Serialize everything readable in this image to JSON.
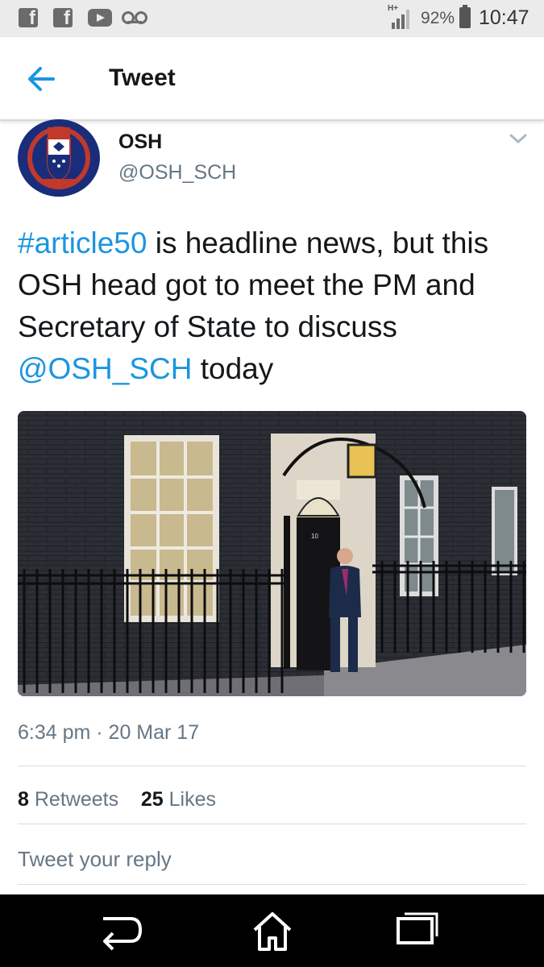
{
  "status_bar": {
    "network": "H+",
    "battery_percent": "92%",
    "battery_level": 0.92,
    "time": "10:47",
    "icons": [
      "facebook-icon",
      "facebook-icon",
      "youtube-icon",
      "voicemail-icon",
      "signal-icon",
      "battery-icon"
    ]
  },
  "app_bar": {
    "title": "Tweet",
    "back_icon": "arrow-left-icon"
  },
  "tweet": {
    "display_name": "OSH",
    "handle": "@OSH_SCH",
    "text": {
      "hashtag": "#article50",
      "part1": " is headline news, but this OSH head got to meet the PM and Secretary of State to discuss ",
      "mention": "@OSH_SCH",
      "part2": " today"
    },
    "image_description": "photo",
    "timestamp": "6:34 pm · 20 Mar 17",
    "retweets_count": "8",
    "retweets_label": "Retweets",
    "likes_count": "25",
    "likes_label": "Likes",
    "reply_placeholder": "Tweet your reply"
  },
  "colors": {
    "link": "#1b95e0",
    "secondary_text": "#657786",
    "primary_text": "#14171a",
    "avatar_bg": "#1a2d7a"
  },
  "nav_bar": {
    "icons": [
      "back-nav-icon",
      "home-nav-icon",
      "recents-nav-icon"
    ]
  }
}
